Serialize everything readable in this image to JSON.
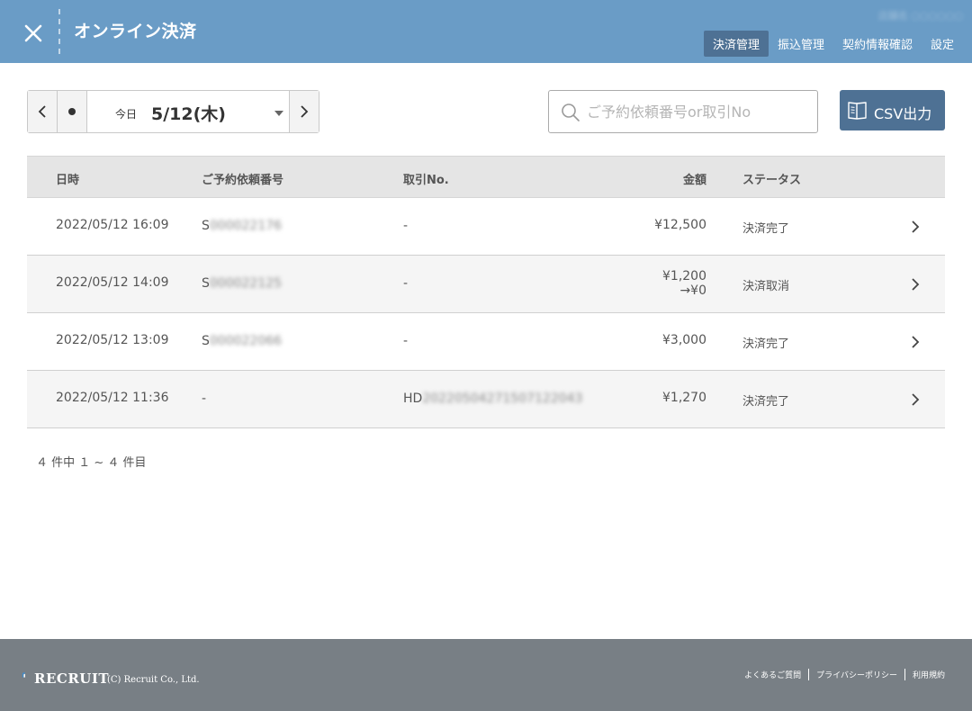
{
  "header": {
    "title": "オンライン決済",
    "store_name": "店舗名 ○○○○○○",
    "nav": [
      "決済管理",
      "振込管理",
      "契約情報確認",
      "設定"
    ],
    "active_nav": "決済管理"
  },
  "toolbar": {
    "today_label": "今日",
    "date_value": "5/12(木)",
    "search_placeholder": "ご予約依頼番号or取引No",
    "search_value": "",
    "csv_label": "CSV出力"
  },
  "table": {
    "columns": [
      "日時",
      "ご予約依頼番号",
      "取引No.",
      "金額",
      "ステータス"
    ],
    "rows": [
      {
        "datetime": "2022/05/12 16:09",
        "reservation_prefix": "S",
        "reservation_rest": "000022176",
        "transaction_prefix": "-",
        "transaction_rest": "",
        "amount": "¥12,500",
        "amount_after": "",
        "status": "決済完了"
      },
      {
        "datetime": "2022/05/12 14:09",
        "reservation_prefix": "S",
        "reservation_rest": "000022125",
        "transaction_prefix": "-",
        "transaction_rest": "",
        "amount": "¥1,200",
        "amount_after": "→¥0",
        "status": "決済取消"
      },
      {
        "datetime": "2022/05/12 13:09",
        "reservation_prefix": "S",
        "reservation_rest": "000022066",
        "transaction_prefix": "-",
        "transaction_rest": "",
        "amount": "¥3,000",
        "amount_after": "",
        "status": "決済完了"
      },
      {
        "datetime": "2022/05/12 11:36",
        "reservation_prefix": "-",
        "reservation_rest": "",
        "transaction_prefix": "HD",
        "transaction_rest": "20220504271507122043",
        "amount": "¥1,270",
        "amount_after": "",
        "status": "決済完了"
      }
    ]
  },
  "pagination": "４ 件中 １ ~ ４ 件目",
  "footer": {
    "logo": "RECRUIT",
    "copyright": "(C) Recruit Co., Ltd.",
    "links": [
      "よくあるご質問",
      "プライバシーポリシー",
      "利用規約"
    ]
  },
  "colors": {
    "header_bg": "#6a9cc6",
    "nav_active_bg": "#4e7194",
    "csv_button_bg": "#4e7194",
    "footer_bg": "#787f85",
    "table_header_bg": "#e5e5e5",
    "row_alt_bg": "#f5f5f5"
  },
  "icons": {
    "close": "close-icon",
    "prev": "chevron-left-icon",
    "next": "chevron-right-icon",
    "today": "dot-icon",
    "dropdown": "caret-down-icon",
    "search": "search-icon",
    "csv": "book-icon",
    "row": "chevron-right-icon"
  }
}
